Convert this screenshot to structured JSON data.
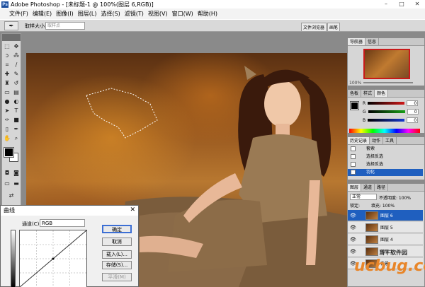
{
  "window": {
    "title": "Adobe Photoshop - [未标题-1 @ 100%(图层 6,RGB)]",
    "minimize": "–",
    "maximize": "□",
    "close": "✕"
  },
  "menu": {
    "items": [
      "文件(F)",
      "编辑(E)",
      "图像(I)",
      "图层(L)",
      "选择(S)",
      "滤镜(T)",
      "视图(V)",
      "窗口(W)",
      "帮助(H)"
    ]
  },
  "options": {
    "tool_icon": "eyedropper-icon",
    "sample_label": "取样大小:",
    "sample_value": "取样点",
    "tabs": [
      "文件浏览器",
      "画笔"
    ]
  },
  "navigator": {
    "tabs": [
      "导航器",
      "信息"
    ],
    "zoom": "100%"
  },
  "color": {
    "tabs": [
      "色板",
      "样式",
      "颜色"
    ],
    "rows": [
      {
        "label": "R",
        "value": "0",
        "color": "#d01818"
      },
      {
        "label": "G",
        "value": "0",
        "color": "#18a018"
      },
      {
        "label": "B",
        "value": "0",
        "color": "#1838d0"
      }
    ]
  },
  "history": {
    "tabs": [
      "历史记录",
      "动作",
      "工具"
    ],
    "items": [
      "套索",
      "选择反选",
      "选择反选",
      "羽化"
    ]
  },
  "layers": {
    "tabs": [
      "图层",
      "通道",
      "路径"
    ],
    "mode": "正常",
    "opacity_label": "不透明度: 100%",
    "lock_label": "锁定:",
    "fill_label": "填充: 100%",
    "rows": [
      "图层 6",
      "图层 5",
      "图层 4",
      "图层 3",
      "背景"
    ]
  },
  "curves": {
    "title": "曲线",
    "channel_label": "通道(C):",
    "channel_value": "RGB",
    "buttons": [
      "确定",
      "取消",
      "载入(L)...",
      "存储(S)...",
      "平滑(M)"
    ]
  },
  "watermark": {
    "line1": "当下软件园",
    "line2": "ucbug.cc"
  }
}
